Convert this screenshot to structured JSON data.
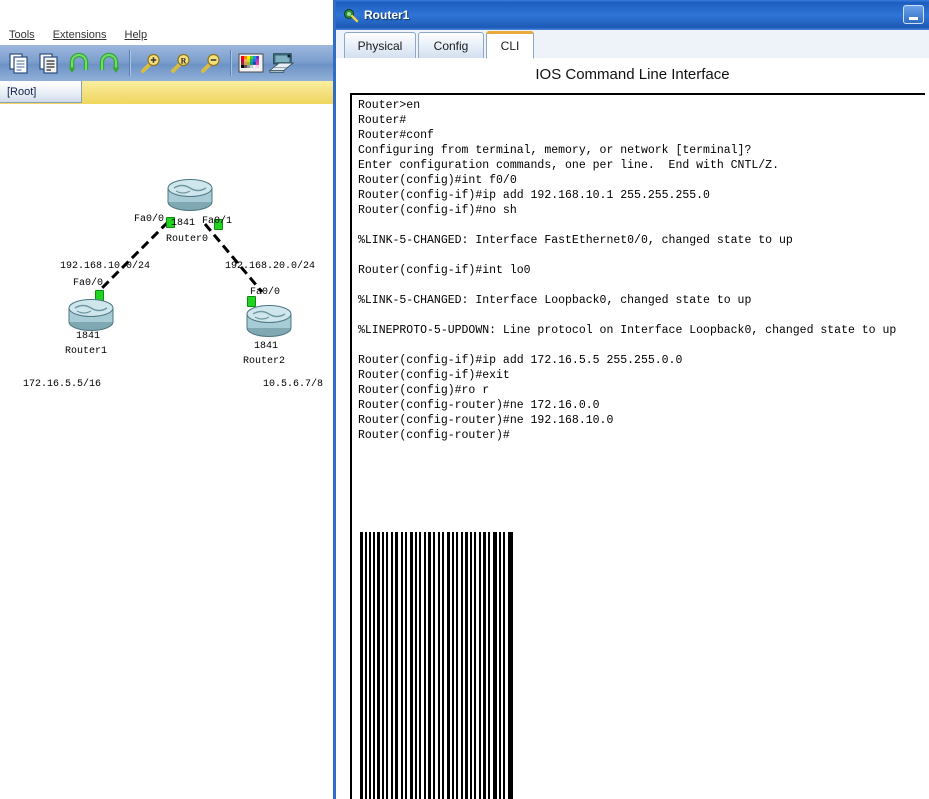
{
  "left_app": {
    "menus": [
      {
        "label": "Tools",
        "accel": "T"
      },
      {
        "label": "Extensions",
        "accel": "E"
      },
      {
        "label": "Help",
        "accel": "H"
      }
    ],
    "toolbar_icons": [
      "new-file-icon",
      "open-file-icon",
      "undo-icon",
      "redo-icon",
      "zoom-in-icon",
      "zoom-reset-icon",
      "zoom-out-icon",
      "palette-icon",
      "drawing-tablet-icon"
    ],
    "zoom_reset_glyph": "R",
    "root_tab_label": "[Root]",
    "topology": {
      "devices": [
        {
          "id": "router0",
          "model": "1841",
          "name": "Router0",
          "interfaces": [
            "Fa0/0",
            "Fa0/1"
          ]
        },
        {
          "id": "router1",
          "model": "1841",
          "name": "Router1",
          "interfaces": [
            "Fa0/0"
          ]
        },
        {
          "id": "router2",
          "model": "1841",
          "name": "Router2",
          "interfaces": [
            "Fa0/0"
          ]
        }
      ],
      "network_labels": [
        "192.168.10.0/24",
        "192.168.20.0/24"
      ],
      "address_labels": [
        "172.16.5.5/16",
        "10.5.6.7/8"
      ],
      "router0_iface_left": "Fa0/0",
      "router0_iface_right": "Fa0/1",
      "router1_iface": "Fa0/0",
      "router2_iface": "Fa0/0",
      "link_status_color": "#22d422"
    }
  },
  "router_window": {
    "title": "Router1",
    "minimize_label": "",
    "tabs": [
      {
        "label": "Physical",
        "active": false
      },
      {
        "label": "Config",
        "active": false
      },
      {
        "label": "CLI",
        "active": true
      }
    ],
    "pane_title": "IOS Command Line Interface",
    "terminal_text": "Router>en\nRouter#\nRouter#conf\nConfiguring from terminal, memory, or network [terminal]?\nEnter configuration commands, one per line.  End with CNTL/Z.\nRouter(config)#int f0/0\nRouter(config-if)#ip add 192.168.10.1 255.255.255.0\nRouter(config-if)#no sh\n\n%LINK-5-CHANGED: Interface FastEthernet0/0, changed state to up\n\nRouter(config-if)#int lo0\n\n%LINK-5-CHANGED: Interface Loopback0, changed state to up\n\n%LINEPROTO-5-UPDOWN: Line protocol on Interface Loopback0, changed state to up\n\nRouter(config-if)#ip add 172.16.5.5 255.255.0.0\nRouter(config-if)#exit\nRouter(config)#ro r\nRouter(config-router)#ne 172.16.0.0\nRouter(config-router)#ne 192.168.10.0\nRouter(config-router)#",
    "accent_color": "#e8aa3c",
    "titlebar_color": "#1d5ab6"
  }
}
